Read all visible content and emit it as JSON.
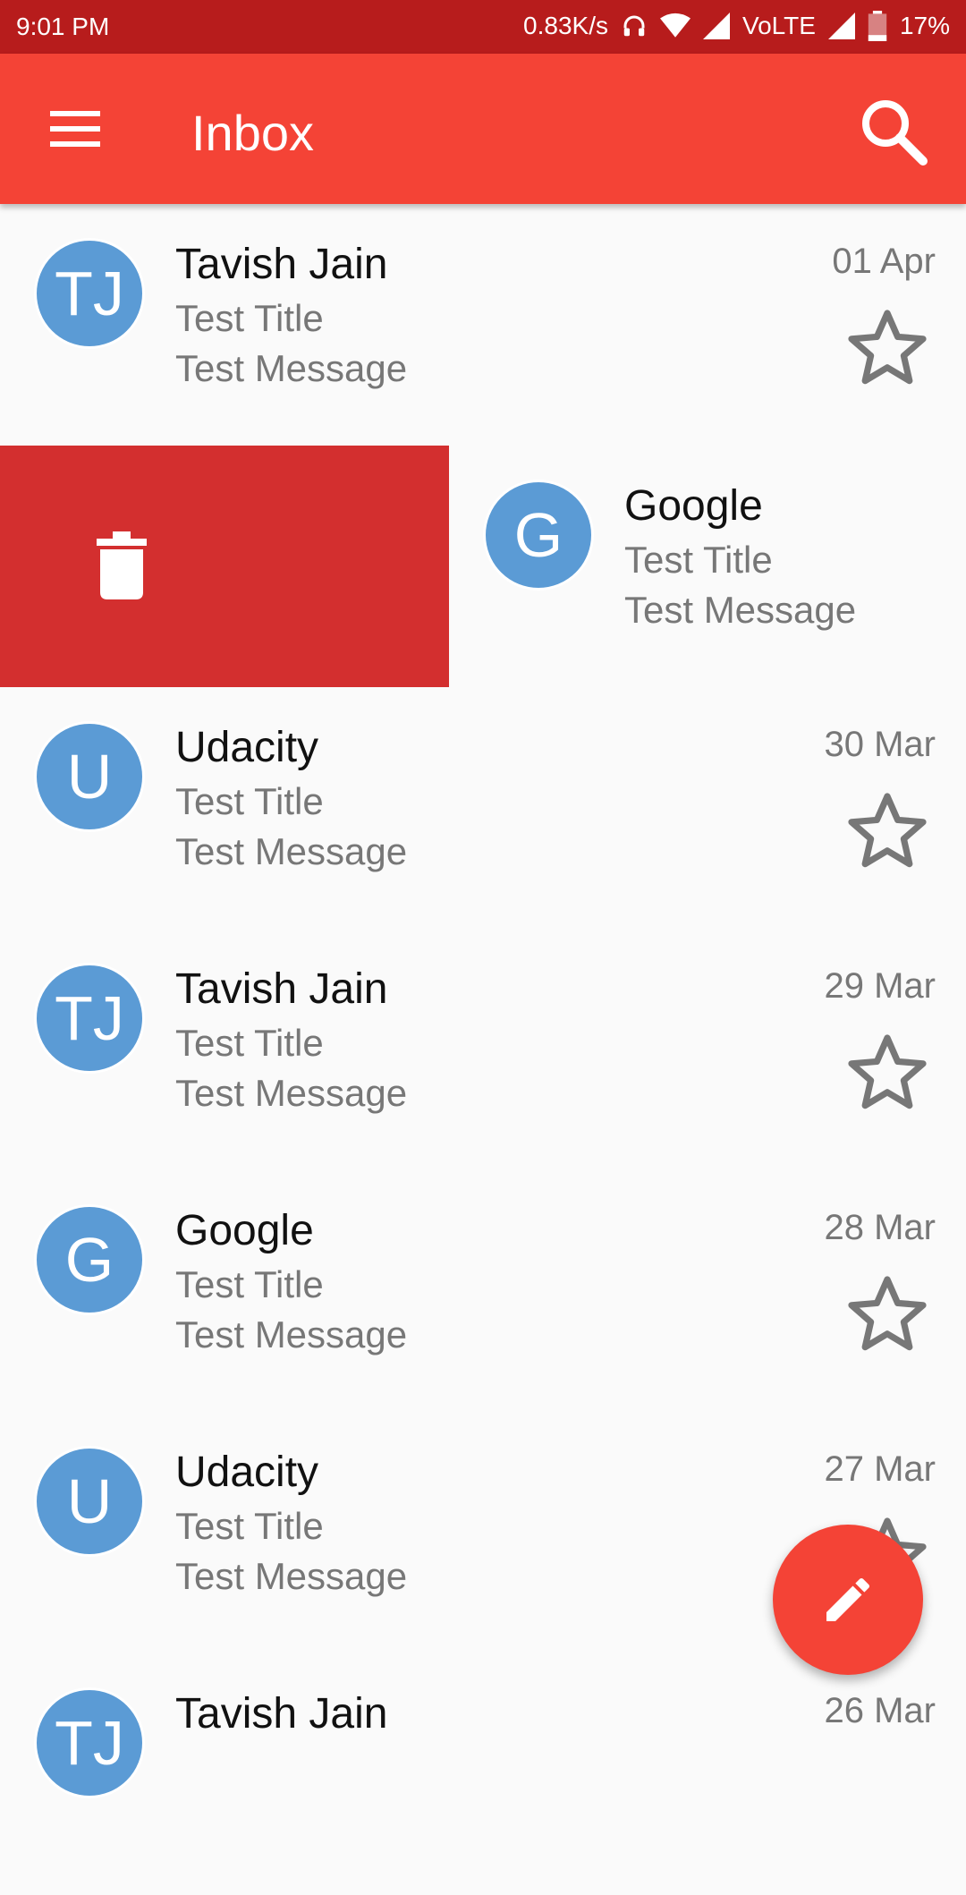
{
  "status_bar": {
    "time": "9:01 PM",
    "network_speed": "0.83K/s",
    "network_type": "VoLTE",
    "battery": "17%"
  },
  "app_bar": {
    "title": "Inbox",
    "menu_icon": "hamburger-menu-icon",
    "search_icon": "search-icon"
  },
  "swipe_action": {
    "icon": "trash-icon",
    "color": "#d32f2f"
  },
  "emails": [
    {
      "initials": "TJ",
      "sender": "Tavish Jain",
      "subject": "Test Title",
      "message": "Test Message",
      "date": "01 Apr"
    },
    {
      "initials": "G",
      "sender": "Google",
      "subject": "Test Title",
      "message": "Test Message",
      "date": ""
    },
    {
      "initials": "U",
      "sender": "Udacity",
      "subject": "Test Title",
      "message": "Test Message",
      "date": "30 Mar"
    },
    {
      "initials": "TJ",
      "sender": "Tavish Jain",
      "subject": "Test Title",
      "message": "Test Message",
      "date": "29 Mar"
    },
    {
      "initials": "G",
      "sender": "Google",
      "subject": "Test Title",
      "message": "Test Message",
      "date": "28 Mar"
    },
    {
      "initials": "U",
      "sender": "Udacity",
      "subject": "Test Title",
      "message": "Test Message",
      "date": "27 Mar"
    },
    {
      "initials": "TJ",
      "sender": "Tavish Jain",
      "subject": "",
      "message": "",
      "date": "26 Mar"
    }
  ],
  "colors": {
    "status_bar": "#b71c1c",
    "app_bar": "#f44336",
    "avatar": "#5b9bd5",
    "fab": "#f44336"
  },
  "fab": {
    "icon": "pencil-edit-icon"
  }
}
